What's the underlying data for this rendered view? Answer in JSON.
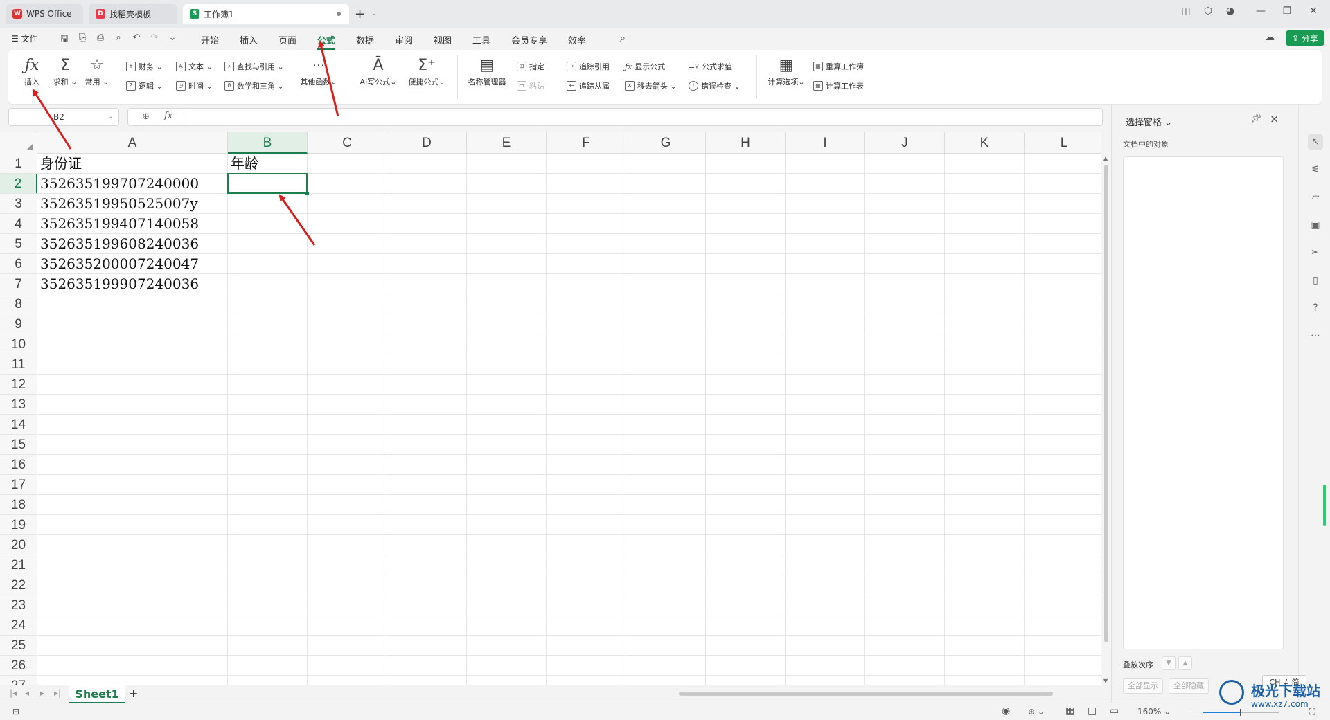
{
  "tabs": [
    {
      "label": "WPS Office"
    },
    {
      "label": "找稻壳模板"
    },
    {
      "label": "工作簿1"
    }
  ],
  "menu": {
    "file": "文件",
    "items": [
      "开始",
      "插入",
      "页面",
      "公式",
      "数据",
      "审阅",
      "视图",
      "工具",
      "会员专享",
      "效率"
    ],
    "active": "公式",
    "share": "分享"
  },
  "ribbon": {
    "insert": "插入",
    "sum": "求和",
    "common": "常用",
    "finance": "财务",
    "text": "文本",
    "lookup": "查找与引用",
    "logic": "逻辑",
    "time": "时间",
    "math": "数学和三角",
    "other": "其他函数",
    "ai": "AI写公式",
    "quick": "便捷公式",
    "name_mgr": "名称管理器",
    "specify": "指定",
    "paste": "粘贴",
    "trace_prec": "追踪引用",
    "trace_dep": "追踪从属",
    "show_formula": "显示公式",
    "remove_arrows": "移去箭头",
    "eval": "公式求值",
    "error_check": "错误检查",
    "calc_opts": "计算选项",
    "recalc_book": "重算工作簿",
    "calc_sheet": "计算工作表"
  },
  "formula_bar": {
    "name_box": "B2",
    "fx": "fx",
    "value": ""
  },
  "grid": {
    "columns": [
      "A",
      "B",
      "C",
      "D",
      "E",
      "F",
      "G",
      "H",
      "I",
      "J",
      "K",
      "L"
    ],
    "rows": [
      "1",
      "2",
      "3",
      "4",
      "5",
      "6",
      "7",
      "8",
      "9",
      "10",
      "11",
      "12",
      "13",
      "14",
      "15",
      "16",
      "17",
      "18",
      "19",
      "20",
      "21",
      "22",
      "23",
      "24",
      "25",
      "26",
      "27"
    ],
    "selected_col": "B",
    "selected_row": "2",
    "cells": {
      "A1": "身份证",
      "B1": "年龄",
      "A2": "352635199707240000",
      "A3": "35263519950525007y",
      "A4": "352635199407140058",
      "A5": "352635199608240036",
      "A6": "352635200007240047",
      "A7": "352635199907240036"
    }
  },
  "sheet": {
    "name": "Sheet1",
    "add": "+"
  },
  "status": {
    "zoom": "160%"
  },
  "pane": {
    "title": "选择窗格",
    "subtitle": "文档中的对象",
    "order": "叠放次序",
    "show_all": "全部显示",
    "hide_all": "全部隐藏"
  },
  "ime": "CH ⊅ 简",
  "watermark": {
    "text": "极光下载站",
    "url": "www.xz7.com"
  },
  "colors": {
    "accent": "#1a7f4b",
    "share": "#1a9b54",
    "annotation": "#d61f1f"
  }
}
